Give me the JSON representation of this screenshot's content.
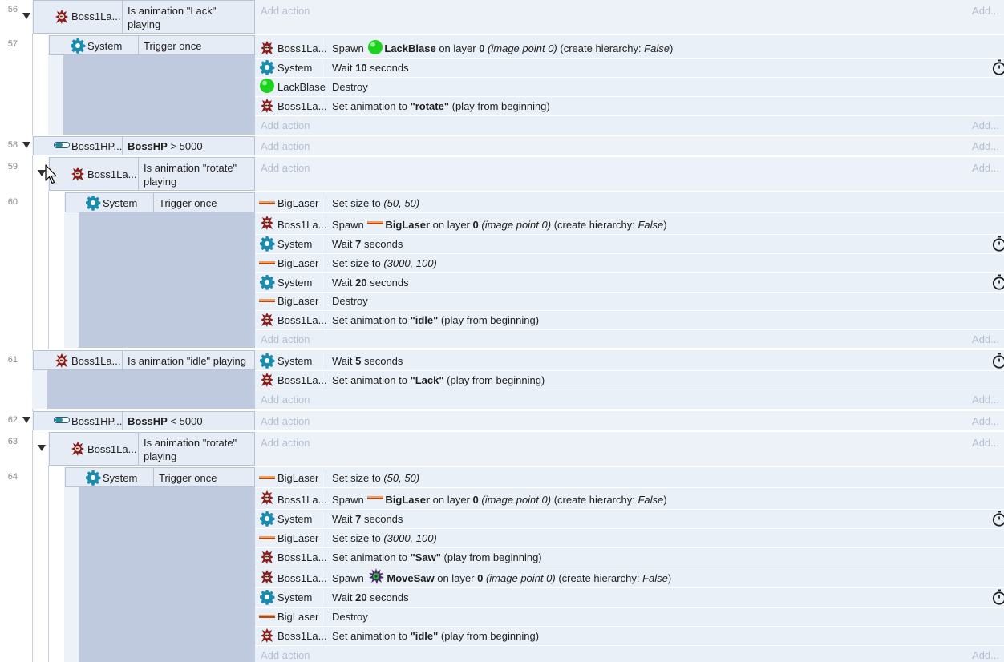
{
  "events": {
    "e56": {
      "line": "56",
      "obj": "Boss1La...",
      "cond": "Is animation \"Lack\" playing",
      "add_action": "Add action",
      "add": "Add..."
    },
    "e57": {
      "line": "57",
      "obj": "System",
      "cond": "Trigger once",
      "a1": {
        "obj": "Boss1La...",
        "pre": "Spawn ",
        "name": "LackBlase",
        "mid": " on layer ",
        "layer": "0",
        "ip": "(image point 0)",
        "ch": "(create hierarchy: ",
        "fv": "False",
        "close": ")"
      },
      "a2": {
        "obj": "System",
        "pre": "Wait ",
        "val": "10",
        "post": " seconds"
      },
      "a3": {
        "obj": "LackBlase",
        "text": "Destroy"
      },
      "a4": {
        "obj": "Boss1La...",
        "pre": "Set animation to ",
        "val": "\"rotate\"",
        "post": " (play from beginning)"
      },
      "add_action": "Add action",
      "add": "Add..."
    },
    "e58": {
      "line": "58",
      "obj": "Boss1HP...",
      "var": "BossHP",
      "op": " > 5000",
      "add_action": "Add action",
      "add": "Add..."
    },
    "e59": {
      "line": "59",
      "obj": "Boss1La...",
      "cond": "Is animation \"rotate\" playing",
      "add_action": "Add action",
      "add": "Add..."
    },
    "e60": {
      "line": "60",
      "obj": "System",
      "cond": "Trigger once",
      "a1": {
        "obj": "BigLaser",
        "pre": "Set size to ",
        "val": "(50, 50)"
      },
      "a2": {
        "obj": "Boss1La...",
        "pre": "Spawn ",
        "name": "BigLaser",
        "mid": " on layer ",
        "layer": "0",
        "ip": "(image point 0)",
        "ch": "(create hierarchy: ",
        "fv": "False",
        "close": ")"
      },
      "a3": {
        "obj": "System",
        "pre": "Wait ",
        "val": "7",
        "post": " seconds"
      },
      "a4": {
        "obj": "BigLaser",
        "pre": "Set size to ",
        "val": "(3000, 100)"
      },
      "a5": {
        "obj": "System",
        "pre": "Wait ",
        "val": "20",
        "post": " seconds"
      },
      "a6": {
        "obj": "BigLaser",
        "text": "Destroy"
      },
      "a7": {
        "obj": "Boss1La...",
        "pre": "Set animation to ",
        "val": "\"idle\"",
        "post": " (play from beginning)"
      },
      "add_action": "Add action",
      "add": "Add..."
    },
    "e61": {
      "line": "61",
      "obj": "Boss1La...",
      "cond": "Is animation \"idle\" playing",
      "a1": {
        "obj": "System",
        "pre": "Wait ",
        "val": "5",
        "post": " seconds"
      },
      "a2": {
        "obj": "Boss1La...",
        "pre": "Set animation to ",
        "val": "\"Lack\"",
        "post": " (play from beginning)"
      },
      "add_action": "Add action",
      "add": "Add..."
    },
    "e62": {
      "line": "62",
      "obj": "Boss1HP...",
      "var": "BossHP",
      "op": " < 5000",
      "add_action": "Add action",
      "add": "Add..."
    },
    "e63": {
      "line": "63",
      "obj": "Boss1La...",
      "cond": "Is animation \"rotate\" playing",
      "add_action": "Add action",
      "add": "Add..."
    },
    "e64": {
      "line": "64",
      "obj": "System",
      "cond": "Trigger once",
      "a1": {
        "obj": "BigLaser",
        "pre": "Set size to ",
        "val": "(50, 50)"
      },
      "a2": {
        "obj": "Boss1La...",
        "pre": "Spawn ",
        "name": "BigLaser",
        "mid": " on layer ",
        "layer": "0",
        "ip": "(image point 0)",
        "ch": "(create hierarchy: ",
        "fv": "False",
        "close": ")"
      },
      "a3": {
        "obj": "System",
        "pre": "Wait ",
        "val": "7",
        "post": " seconds"
      },
      "a4": {
        "obj": "BigLaser",
        "pre": "Set size to ",
        "val": "(3000, 100)"
      },
      "a5": {
        "obj": "Boss1La...",
        "pre": "Set animation to ",
        "val": "\"Saw\"",
        "post": " (play from beginning)"
      },
      "a6": {
        "obj": "Boss1La...",
        "pre": "Spawn ",
        "name": "MoveSaw",
        "mid": " on layer ",
        "layer": "0",
        "ip": "(image point 0)",
        "ch": "(create hierarchy: ",
        "fv": "False",
        "close": ")"
      },
      "a7": {
        "obj": "System",
        "pre": "Wait ",
        "val": "20",
        "post": " seconds"
      },
      "a8": {
        "obj": "BigLaser",
        "text": "Destroy"
      },
      "a9": {
        "obj": "Boss1La...",
        "pre": "Set animation to ",
        "val": "\"idle\"",
        "post": " (play from beginning)"
      },
      "add_action": "Add action",
      "add": "Add..."
    }
  },
  "icons": {
    "boss": "boss-sprite-icon",
    "system": "gear-icon",
    "lackblase": "green-orb-icon",
    "biglaser": "laser-beam-icon",
    "movesaw": "spiked-saw-icon",
    "hp": "hp-bar-icon",
    "wait": "stopwatch-icon",
    "collapse": "collapse-triangle-icon"
  },
  "colors": {
    "event_bg": "#edf1f8",
    "condition_bg": "#e6ecf5",
    "condition_fill": "#bfcade",
    "gear": "#1a8cb0",
    "orb": "#22dd22",
    "laser": "#c86a2a"
  }
}
